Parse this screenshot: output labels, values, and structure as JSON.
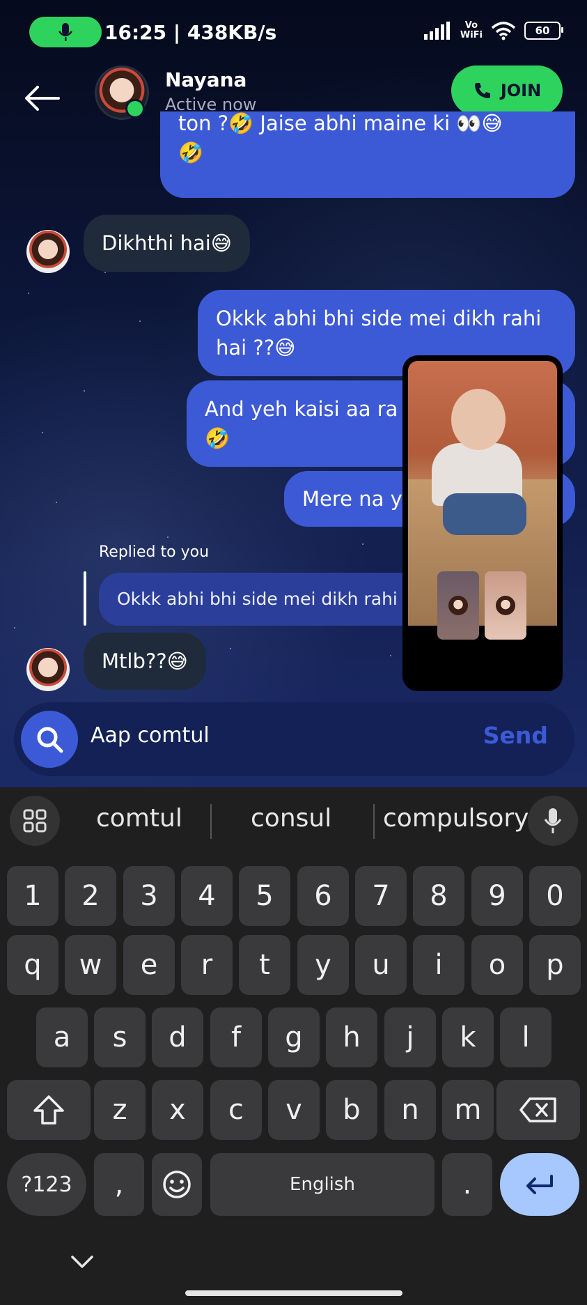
{
  "status_bar": {
    "time_speed": "16:25 | 438KB/s",
    "vowifi_top": "Vo",
    "vowifi_bottom": "WiFi",
    "battery": "60"
  },
  "header": {
    "contact_name": "Nayana",
    "contact_status": "Active now",
    "join_label": "JOIN"
  },
  "messages": {
    "m1_line1": "ton ?🤣 Jaise abhi maine ki 👀😅",
    "m1_line2": "🤣",
    "m2": "Dikhthi hai😅",
    "m3_line1": "Okkk abhi bhi side mei dikh rahi",
    "m3_line2": "hai ??😅",
    "m4_line1": "And yeh kaisi aa ra",
    "m4_line2": "🤣",
    "m5": "Mere na y",
    "reply_label": "Replied to you",
    "reply_quote": "Okkk abhi bhi side mei dikh rahi",
    "m6": "Mtlb??😅"
  },
  "input": {
    "text": "Aap comtul",
    "send_label": "Send"
  },
  "keyboard": {
    "suggestions": [
      "comtul",
      "consul",
      "compulsory"
    ],
    "row_numbers": [
      "1",
      "2",
      "3",
      "4",
      "5",
      "6",
      "7",
      "8",
      "9",
      "0"
    ],
    "row_q": [
      "q",
      "w",
      "e",
      "r",
      "t",
      "y",
      "u",
      "i",
      "o",
      "p"
    ],
    "row_a": [
      "a",
      "s",
      "d",
      "f",
      "g",
      "h",
      "j",
      "k",
      "l"
    ],
    "row_z": [
      "z",
      "x",
      "c",
      "v",
      "b",
      "n",
      "m"
    ],
    "symbols_label": "?123",
    "comma": ",",
    "space_label": "English",
    "period": "."
  },
  "colors": {
    "accent_green": "#2ed35d",
    "bubble_blue": "#3d5ad6",
    "enter_blue": "#a6c8ff"
  },
  "icons": [
    "mic-icon",
    "back-arrow-icon",
    "phone-icon",
    "search-icon",
    "grid-icon",
    "shift-icon",
    "backspace-icon",
    "emoji-icon",
    "enter-icon",
    "chevron-down-icon"
  ]
}
